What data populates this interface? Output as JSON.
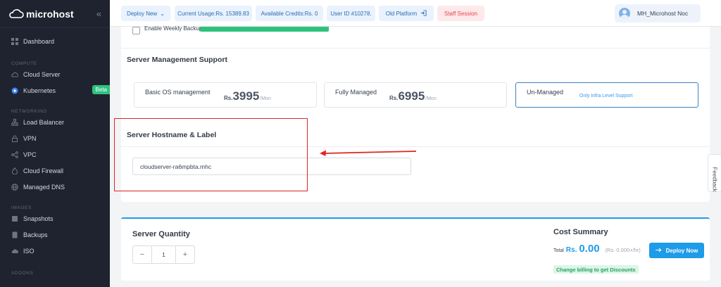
{
  "brand": {
    "name": "microhost"
  },
  "sidebar": {
    "items": [
      {
        "label": "Dashboard",
        "icon": "dashboard-icon"
      },
      {
        "section": "COMPUTE"
      },
      {
        "label": "Cloud Server",
        "icon": "cloud-icon"
      },
      {
        "label": "Kubernetes",
        "icon": "kubernetes-icon",
        "badge": "Beta"
      },
      {
        "section": "NETWORKING"
      },
      {
        "label": "Load Balancer",
        "icon": "network-icon"
      },
      {
        "label": "VPN",
        "icon": "lock-icon"
      },
      {
        "label": "VPC",
        "icon": "share-icon"
      },
      {
        "label": "Cloud Firewall",
        "icon": "firewall-icon"
      },
      {
        "label": "Managed DNS",
        "icon": "globe-icon"
      },
      {
        "section": "IMAGES"
      },
      {
        "label": "Snapshots",
        "icon": "snapshot-icon"
      },
      {
        "label": "Backups",
        "icon": "backup-icon"
      },
      {
        "label": "ISO",
        "icon": "iso-icon"
      },
      {
        "section": "ADDONS"
      }
    ]
  },
  "topbar": {
    "deploy_new": "Deploy New",
    "usage": "Current Usage:Rs. 15389.83",
    "credits": "Available Credits:Rs. 0",
    "user_id": "User ID #10278.",
    "old_platform": "Old Platform",
    "staff_session": "Staff Session",
    "user_name": "MH_Microhost Noc"
  },
  "backup": {
    "label": "Enable Weekly Backup"
  },
  "management": {
    "title": "Server Management Support",
    "options": [
      {
        "name": "Basic OS management",
        "currency": "Rs.",
        "amount": "3995",
        "per": "/Mon"
      },
      {
        "name": "Fully Managed",
        "currency": "Rs.",
        "amount": "6995",
        "per": "/Mon"
      },
      {
        "name": "Un-Managed",
        "note": "Only Infra Level Support"
      }
    ]
  },
  "hostname": {
    "title": "Server Hostname & Label",
    "value": "cloudserver-ra6mpbta.mhc"
  },
  "feedback": "Feedback",
  "quantity": {
    "title": "Server Quantity",
    "value": "1",
    "dec": "−",
    "inc": "+"
  },
  "cost": {
    "title": "Cost Summary",
    "total_label": "Total",
    "currency": "Rs.",
    "amount": "0.00",
    "rate": "(Rs. 0.000+/hr)",
    "deploy_label": "Deploy Now",
    "discount": "Change billing to get Discounts"
  },
  "colors": {
    "accent": "#1e9be9",
    "sidebar_bg": "#1f2330",
    "beta": "#2ec27e",
    "annotation": "#e02424"
  }
}
